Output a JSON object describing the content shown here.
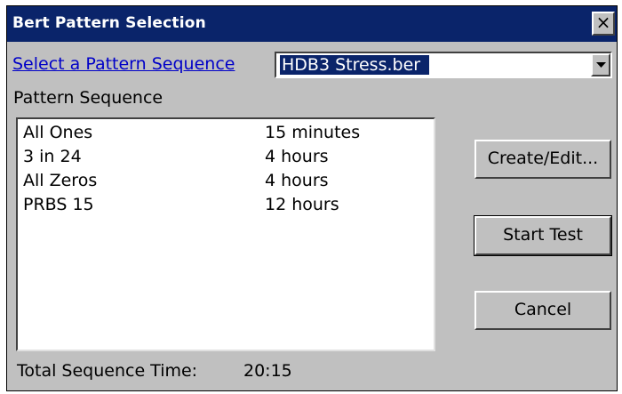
{
  "window": {
    "title": "Bert Pattern Selection",
    "close_glyph": "×"
  },
  "selector": {
    "link_label": "Select a Pattern Sequence",
    "selected": "HDB3 Stress.ber"
  },
  "sequence": {
    "label": "Pattern Sequence",
    "items": [
      {
        "name": "All Ones",
        "duration": "15 minutes"
      },
      {
        "name": "3 in 24",
        "duration": "4 hours"
      },
      {
        "name": "All Zeros",
        "duration": "4 hours"
      },
      {
        "name": "PRBS 15",
        "duration": "12 hours"
      }
    ]
  },
  "buttons": {
    "create_edit": "Create/Edit...",
    "start_test": "Start Test",
    "cancel": "Cancel"
  },
  "footer": {
    "total_label": "Total Sequence Time:",
    "total_value": "20:15"
  },
  "colors": {
    "titlebar": "#0a246a",
    "dialog_bg": "#c0c0c0",
    "link": "#0000c8"
  }
}
